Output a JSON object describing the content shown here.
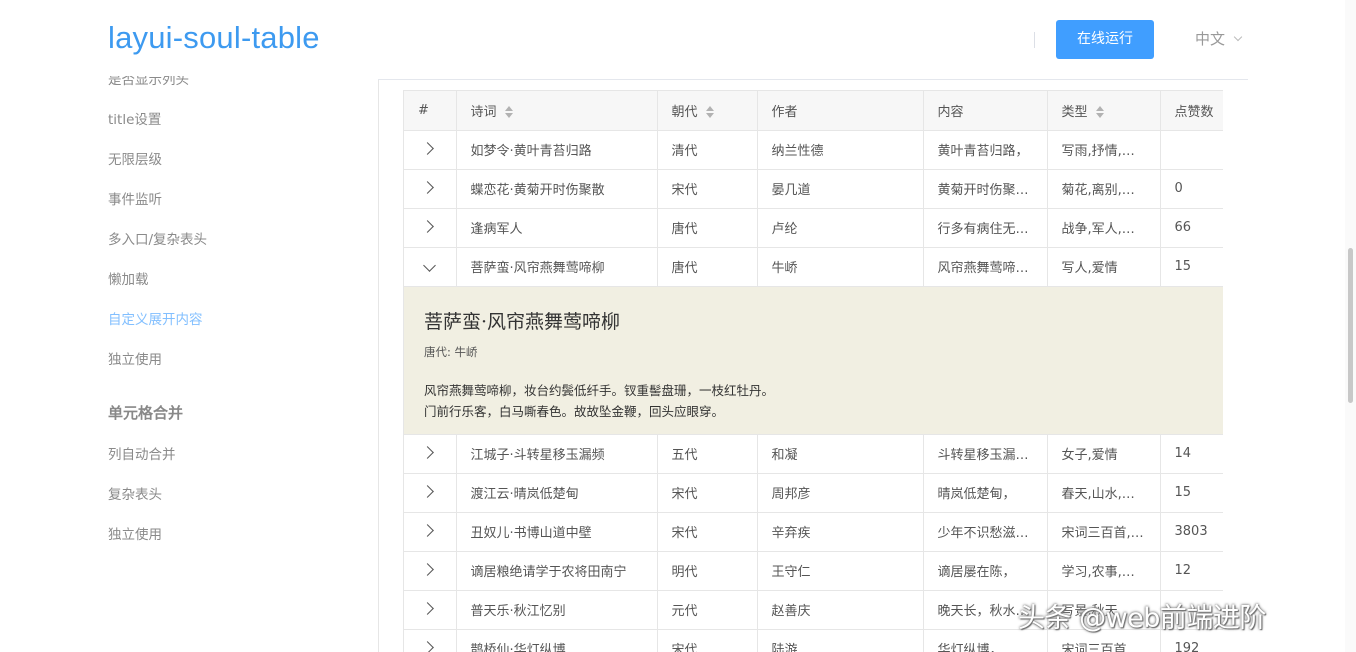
{
  "header": {
    "logo": "layui-soul-table",
    "run_button": "在线运行",
    "language": "中文"
  },
  "sidebar": {
    "items_top": [
      {
        "label": "是否显示列头"
      },
      {
        "label": "title设置"
      },
      {
        "label": "无限层级"
      },
      {
        "label": "事件监听"
      },
      {
        "label": "多入口/复杂表头"
      },
      {
        "label": "懒加载"
      },
      {
        "label": "自定义展开内容"
      },
      {
        "label": "独立使用"
      }
    ],
    "group_title": "单元格合并",
    "items_bottom": [
      {
        "label": "列自动合并"
      },
      {
        "label": "复杂表头"
      },
      {
        "label": "独立使用"
      }
    ]
  },
  "table": {
    "headers": [
      "#",
      "诗词",
      "朝代",
      "作者",
      "内容",
      "类型",
      "点赞数"
    ],
    "rows_before": [
      [
        "如梦令·黄叶青苔归路",
        "清代",
        "纳兰性德",
        "黄叶青苔归路，",
        "写雨,抒情,怀人",
        ""
      ],
      [
        "蝶恋花·黄菊开时伤聚散",
        "宋代",
        "晏几道",
        "黄菊开时伤聚散，",
        "菊花,离别,伤感",
        "0"
      ],
      [
        "逢病军人",
        "唐代",
        "卢纶",
        "行多有病住无粮，",
        "战争,军人,同情",
        "66"
      ],
      [
        "菩萨蛮·风帘燕舞莺啼柳",
        "唐代",
        "牛峤",
        "风帘燕舞莺啼柳，",
        "写人,爱情",
        "15"
      ]
    ],
    "expanded": {
      "title": "菩萨蛮·风帘燕舞莺啼柳",
      "meta": "唐代: 牛峤",
      "line1": "风帘燕舞莺啼柳，妆台约鬓低纤手。钗重髻盘珊，一枝红牡丹。",
      "line2": "门前行乐客，白马嘶春色。故故坠金鞭，回头应眼穿。"
    },
    "rows_after": [
      [
        "江城子·斗转星移玉漏频",
        "五代",
        "和凝",
        "斗转星移玉漏频，",
        "女子,爱情",
        "14"
      ],
      [
        "渡江云·晴岚低楚甸",
        "宋代",
        "周邦彦",
        "晴岚低楚甸，",
        "春天,山水,思乡",
        "15"
      ],
      [
        "丑奴儿·书博山道中壁",
        "宋代",
        "辛弃疾",
        "少年不识愁滋味，",
        "宋词三百首,抒情",
        "3803"
      ],
      [
        "谪居粮绝请学于农将田南宁",
        "明代",
        "王守仁",
        "谪居屡在陈，",
        "学习,农事,田园",
        "12"
      ],
      [
        "普天乐·秋江忆别",
        "元代",
        "赵善庆",
        "晚天长，秋水苍。",
        "写景,秋天",
        ""
      ],
      [
        "鹊桥仙·华灯纵博",
        "宋代",
        "陆游",
        "华灯纵博，",
        "宋词三百首",
        "192"
      ]
    ]
  },
  "watermark": "头条 @web前端进阶"
}
